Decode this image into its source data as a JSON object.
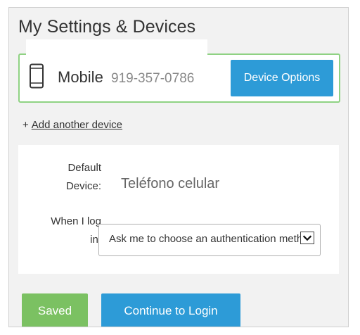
{
  "page": {
    "title": "My Settings & Devices"
  },
  "device": {
    "name": "Mobile",
    "number": "919-357-0786",
    "icon": "phone-icon",
    "options_label": "Device Options"
  },
  "add_device": {
    "prefix": "+",
    "label": "Add another device"
  },
  "settings": {
    "default_device_label_line1": "Default",
    "default_device_label_line2": "Device:",
    "default_device_value": "Teléfono celular",
    "login_label_line1": "When I log",
    "login_label_line2": "in:",
    "login_selected": "Ask me to choose an authentication method"
  },
  "actions": {
    "saved_label": "Saved",
    "continue_label": "Continue to Login"
  },
  "colors": {
    "primary_blue": "#2d9bd7",
    "success_green": "#7bc162",
    "card_border": "#8fd283"
  }
}
